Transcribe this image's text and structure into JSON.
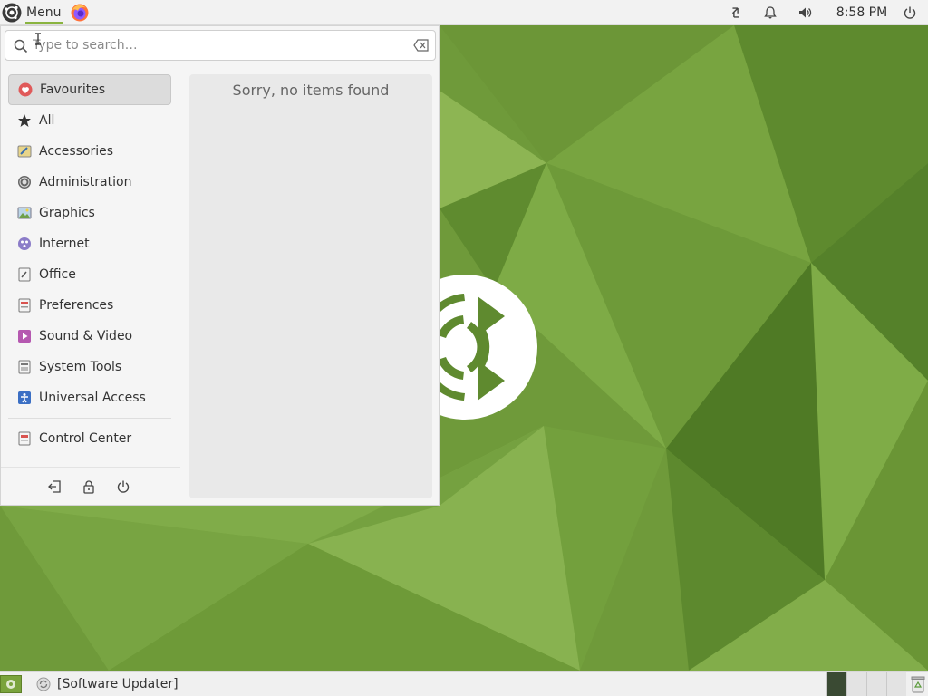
{
  "top_panel": {
    "menu_label": "Menu",
    "menu_icon": "ubuntu-mate-logo-icon",
    "launcher_icon": "firefox-icon",
    "tray_icons": [
      "network-transfer-icon",
      "notification-bell-icon",
      "volume-icon",
      "power-icon"
    ],
    "clock": "8:58 PM"
  },
  "menu": {
    "search": {
      "placeholder": "Type to search…",
      "value": ""
    },
    "categories": [
      {
        "label": "Favourites",
        "icon": "heart-icon",
        "active": true
      },
      {
        "label": "All",
        "icon": "star-icon"
      },
      {
        "label": "Accessories",
        "icon": "accessories-icon"
      },
      {
        "label": "Administration",
        "icon": "administration-icon"
      },
      {
        "label": "Graphics",
        "icon": "graphics-icon"
      },
      {
        "label": "Internet",
        "icon": "internet-icon"
      },
      {
        "label": "Office",
        "icon": "office-icon"
      },
      {
        "label": "Preferences",
        "icon": "preferences-icon"
      },
      {
        "label": "Sound & Video",
        "icon": "sound-video-icon"
      },
      {
        "label": "System Tools",
        "icon": "system-tools-icon"
      },
      {
        "label": "Universal Access",
        "icon": "universal-access-icon"
      }
    ],
    "control_center": {
      "label": "Control Center",
      "icon": "control-center-icon"
    },
    "session_buttons": [
      "logout-icon",
      "lock-icon",
      "shutdown-icon"
    ],
    "empty_message": "Sorry, no items found"
  },
  "bottom_panel": {
    "tasks": [
      {
        "label": "[Software Updater]",
        "icon": "software-updater-icon"
      }
    ],
    "workspaces": 4,
    "active_workspace": 1
  },
  "colors": {
    "accent": "#8ab440",
    "desktop_green": "#6f9a3a"
  }
}
